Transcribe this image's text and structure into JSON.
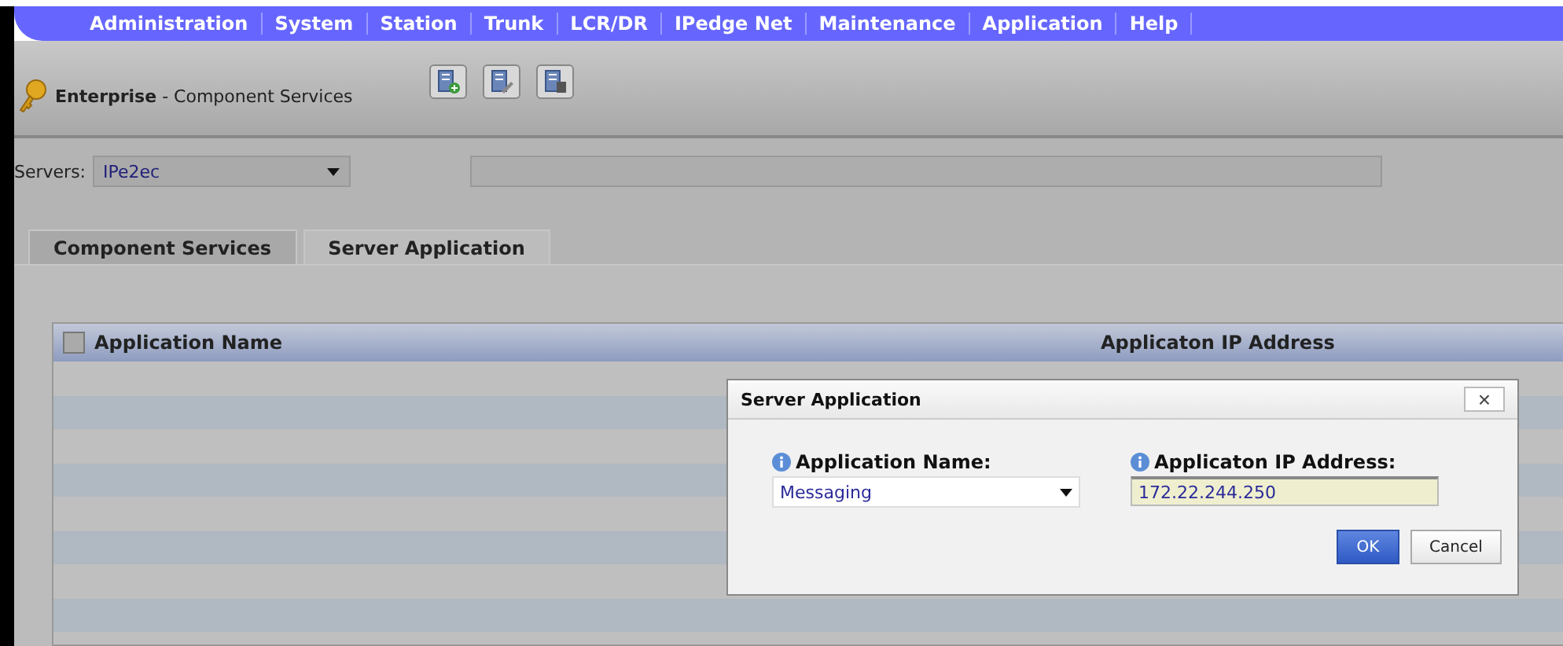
{
  "menu": [
    "Administration",
    "System",
    "Station",
    "Trunk",
    "LCR/DR",
    "IPedge Net",
    "Maintenance",
    "Application",
    "Help"
  ],
  "header": {
    "title": "Enterprise",
    "subtitle": " - Component Services"
  },
  "servers": {
    "label": "Servers:",
    "value": "IPe2ec"
  },
  "tabs": [
    {
      "label": "Component Services",
      "selected": false
    },
    {
      "label": "Server Application",
      "selected": true
    }
  ],
  "table": {
    "select_all_checked": false,
    "columns": [
      "Application Name",
      "Applicaton IP Address"
    ]
  },
  "dialog": {
    "title": "Server Application",
    "close": "×",
    "fields": [
      {
        "kind": "select",
        "label": "Application Name:",
        "value": "Messaging"
      },
      {
        "kind": "text",
        "label": "Applicaton IP Address:",
        "value": "172.22.244.250"
      }
    ],
    "buttons": [
      {
        "label": "OK",
        "primary": true
      },
      {
        "label": "Cancel",
        "primary": false
      }
    ]
  }
}
